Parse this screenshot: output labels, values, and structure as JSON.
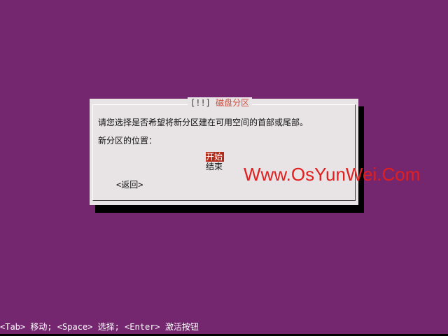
{
  "dialog": {
    "title_open": "[!!]",
    "title_text": "磁盘分区",
    "prompt": "请您选择是否希望将新分区建在可用空间的首部或尾部。",
    "position_label": "新分区的位置：",
    "options": [
      {
        "label": "开始",
        "selected": true
      },
      {
        "label": "结束",
        "selected": false
      }
    ],
    "back_button": "<返回>"
  },
  "watermark": "Www.OsYunWei.Com",
  "status_bar": "<Tab> 移动; <Space> 选择; <Enter> 激活按钮",
  "colors": {
    "background": "#74266f",
    "dialog_bg": "#e8e4e6",
    "selection": "#b42b1a",
    "title": "#d14a3b",
    "watermark": "#e11f1f"
  }
}
